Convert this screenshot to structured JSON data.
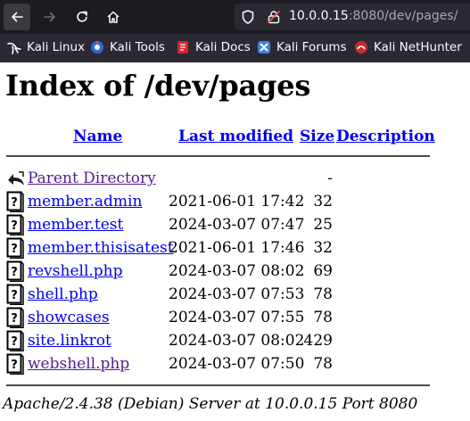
{
  "browser": {
    "url_host": "10.0.0.15",
    "url_rest": ":8080/dev/pages/",
    "bookmarks": [
      {
        "label": "Kali Linux",
        "icon": "kali-linux-icon"
      },
      {
        "label": "Kali Tools",
        "icon": "kali-tools-icon"
      },
      {
        "label": "Kali Docs",
        "icon": "kali-docs-icon"
      },
      {
        "label": "Kali Forums",
        "icon": "kali-forums-icon"
      },
      {
        "label": "Kali NetHunter",
        "icon": "kali-nethunter-icon"
      }
    ]
  },
  "page": {
    "title": "Index of /dev/pages",
    "headers": {
      "name": "Name",
      "last_modified": "Last modified",
      "size": "Size",
      "description": "Description"
    },
    "rows": [
      {
        "name": "Parent Directory",
        "date": "",
        "size": "-",
        "icon": "back-folder-icon",
        "visited": true
      },
      {
        "name": "member.admin",
        "date": "2021-06-01 17:42",
        "size": "32",
        "icon": "unknown-file-icon",
        "visited": false
      },
      {
        "name": "member.test",
        "date": "2024-03-07 07:47",
        "size": "25",
        "icon": "unknown-file-icon",
        "visited": false
      },
      {
        "name": "member.thisisatest",
        "date": "2021-06-01 17:46",
        "size": "32",
        "icon": "unknown-file-icon",
        "visited": false
      },
      {
        "name": "revshell.php",
        "date": "2024-03-07 08:02",
        "size": "69",
        "icon": "unknown-file-icon",
        "visited": false
      },
      {
        "name": "shell.php",
        "date": "2024-03-07 07:53",
        "size": "78",
        "icon": "unknown-file-icon",
        "visited": false
      },
      {
        "name": "showcases",
        "date": "2024-03-07 07:55",
        "size": "78",
        "icon": "unknown-file-icon",
        "visited": false
      },
      {
        "name": "site.linkrot",
        "date": "2024-03-07 08:02",
        "size": "429",
        "icon": "unknown-file-icon",
        "visited": false
      },
      {
        "name": "webshell.php",
        "date": "2024-03-07 07:50",
        "size": "78",
        "icon": "unknown-file-icon",
        "visited": true
      }
    ],
    "footer": "Apache/2.4.38 (Debian) Server at 10.0.0.15 Port 8080"
  },
  "colors": {
    "link": "#0000ee",
    "visited": "#551a8b",
    "chrome_dark": "#1c1b22",
    "chrome_mid": "#2b2a33"
  }
}
